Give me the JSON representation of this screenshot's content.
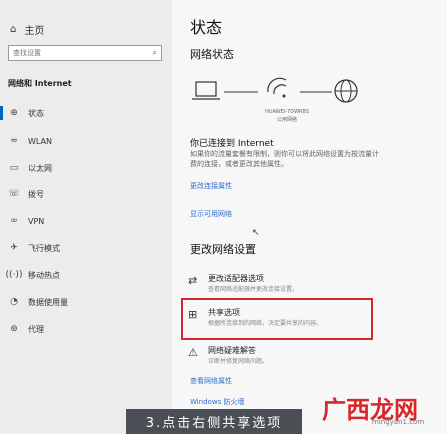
{
  "sidebar": {
    "back_label": "主页",
    "search_placeholder": "查找设置",
    "section_title": "网络和 Internet",
    "items": [
      {
        "label": "状态",
        "icon": "status-icon"
      },
      {
        "label": "WLAN",
        "icon": "wifi-icon"
      },
      {
        "label": "以太网",
        "icon": "ethernet-icon"
      },
      {
        "label": "拨号",
        "icon": "dialup-icon"
      },
      {
        "label": "VPN",
        "icon": "vpn-icon"
      },
      {
        "label": "飞行模式",
        "icon": "airplane-icon"
      },
      {
        "label": "移动热点",
        "icon": "hotspot-icon"
      },
      {
        "label": "数据使用量",
        "icon": "data-usage-icon"
      },
      {
        "label": "代理",
        "icon": "proxy-icon"
      }
    ]
  },
  "main": {
    "title": "状态",
    "network_status_heading": "网络状态",
    "network_name": "HUAWEI-7DWR8S",
    "network_type": "公用网络",
    "connected_heading": "你已连接到 Internet",
    "connected_desc_1": "如果你的流量套餐有限制，则你可以将此网络设置为按流量计",
    "connected_desc_2": "费的连接，或者更改其他属性。",
    "change_props_link": "更改连接属性",
    "show_networks_link": "显示可用网络",
    "change_settings_heading": "更改网络设置",
    "options": [
      {
        "title": "更改适配器选项",
        "desc": "查看网络适配器并更改连接设置。",
        "icon": "adapter-icon"
      },
      {
        "title": "共享选项",
        "desc": "根据所连接到的网络，决定要共享的内容。",
        "icon": "sharing-icon"
      },
      {
        "title": "网络疑难解答",
        "desc": "诊断并修复网络问题。",
        "icon": "troubleshoot-icon"
      }
    ],
    "link_1": "查看网络属性",
    "link_2": "Windows 防火墙"
  },
  "overlay": {
    "caption": "3.点击右侧共享选项",
    "watermark": "广西龙网",
    "watermark_url": "mingyan1.com",
    "highlight_color": "#d9252c"
  }
}
